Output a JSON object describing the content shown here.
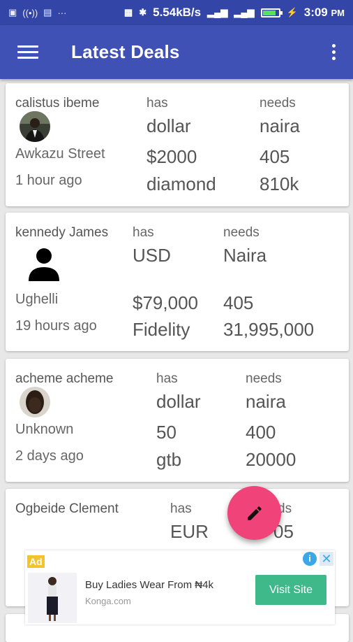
{
  "status": {
    "speed": "5.54kB/s",
    "time": "3:09",
    "ampm": "PM"
  },
  "appbar": {
    "title": "Latest Deals"
  },
  "deals": [
    {
      "name": "calistus ibeme",
      "location": "Awkazu Street",
      "time": "1 hour ago",
      "has_label": "has",
      "needs_label": "needs",
      "has_currency": "dollar",
      "has_amount": "$2000",
      "has_bank": "diamond",
      "needs_currency": "naira",
      "needs_rate": "405",
      "needs_amount": "810k"
    },
    {
      "name": "kennedy James",
      "location": "Ughelli",
      "time": "19 hours ago",
      "has_label": "has",
      "needs_label": "needs",
      "has_currency": "USD",
      "has_amount": "$79,000",
      "has_bank": "Fidelity",
      "needs_currency": "Naira",
      "needs_rate": "405",
      "needs_amount": "31,995,000"
    },
    {
      "name": "acheme acheme",
      "location": "Unknown",
      "time": "2 days ago",
      "has_label": "has",
      "needs_label": "needs",
      "has_currency": "dollar",
      "has_amount": "50",
      "has_bank": "gtb",
      "needs_currency": "naira",
      "needs_rate": "400",
      "needs_amount": "20000"
    },
    {
      "name": "Ogbeide Clement",
      "has_label": "has",
      "needs_label": "ds",
      "has_currency": "EUR",
      "needs_rate": "05"
    }
  ],
  "ad": {
    "badge": "Ad",
    "title": "Buy Ladies Wear From ₦4k",
    "domain": "Konga.com",
    "cta": "Visit Site"
  },
  "colors": {
    "appbar": "#3f51b5",
    "fab": "#f0437a",
    "ad_button": "#3fb98a"
  }
}
